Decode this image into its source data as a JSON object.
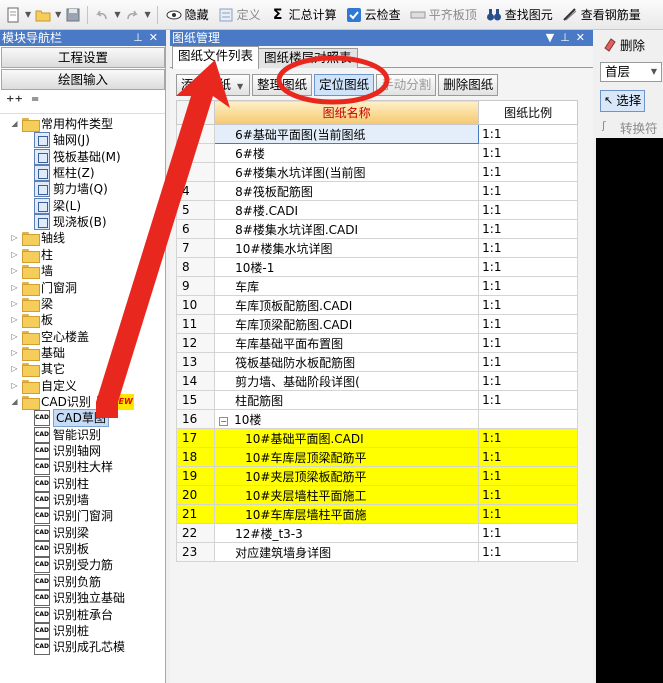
{
  "toolbar": {
    "hide_label": "隐藏",
    "define_label": "定义",
    "summary_label": "汇总计算",
    "cloud_check_label": "云检查",
    "flat_slab_label": "平齐板顶",
    "find_element_label": "查找图元",
    "view_rebar_label": "查看钢筋量"
  },
  "left_panel": {
    "title": "模块导航栏",
    "engineering_settings": "工程设置",
    "drawing_input": "绘图输入",
    "tree": [
      {
        "label": "常用构件类型",
        "kind": "folder",
        "level": 1,
        "expanded": true
      },
      {
        "label": "轴网(J)",
        "kind": "leaf",
        "level": 2
      },
      {
        "label": "筏板基础(M)",
        "kind": "leaf",
        "level": 2
      },
      {
        "label": "框柱(Z)",
        "kind": "leaf",
        "level": 2
      },
      {
        "label": "剪力墙(Q)",
        "kind": "leaf",
        "level": 2
      },
      {
        "label": "梁(L)",
        "kind": "leaf",
        "level": 2
      },
      {
        "label": "现浇板(B)",
        "kind": "leaf",
        "level": 2
      },
      {
        "label": "轴线",
        "kind": "folder",
        "level": 1
      },
      {
        "label": "柱",
        "kind": "folder",
        "level": 1
      },
      {
        "label": "墙",
        "kind": "folder",
        "level": 1
      },
      {
        "label": "门窗洞",
        "kind": "folder",
        "level": 1
      },
      {
        "label": "梁",
        "kind": "folder",
        "level": 1
      },
      {
        "label": "板",
        "kind": "folder",
        "level": 1
      },
      {
        "label": "空心楼盖",
        "kind": "folder",
        "level": 1
      },
      {
        "label": "基础",
        "kind": "folder",
        "level": 1
      },
      {
        "label": "其它",
        "kind": "folder",
        "level": 1
      },
      {
        "label": "自定义",
        "kind": "folder",
        "level": 1
      },
      {
        "label": "CAD识别",
        "kind": "folder",
        "level": 1,
        "expanded": true,
        "badge": "NEW"
      },
      {
        "label": "CAD草图",
        "kind": "cad",
        "level": 2,
        "selected": true
      },
      {
        "label": "智能识别",
        "kind": "cad",
        "level": 2
      },
      {
        "label": "识别轴网",
        "kind": "cad",
        "level": 2
      },
      {
        "label": "识别柱大样",
        "kind": "cad",
        "level": 2
      },
      {
        "label": "识别柱",
        "kind": "cad",
        "level": 2
      },
      {
        "label": "识别墙",
        "kind": "cad",
        "level": 2
      },
      {
        "label": "识别门窗洞",
        "kind": "cad",
        "level": 2
      },
      {
        "label": "识别梁",
        "kind": "cad",
        "level": 2
      },
      {
        "label": "识别板",
        "kind": "cad",
        "level": 2
      },
      {
        "label": "识别受力筋",
        "kind": "cad",
        "level": 2
      },
      {
        "label": "识别负筋",
        "kind": "cad",
        "level": 2
      },
      {
        "label": "识别独立基础",
        "kind": "cad",
        "level": 2
      },
      {
        "label": "识别桩承台",
        "kind": "cad",
        "level": 2
      },
      {
        "label": "识别桩",
        "kind": "cad",
        "level": 2
      },
      {
        "label": "识别成孔芯模",
        "kind": "cad",
        "level": 2
      }
    ]
  },
  "drawing_manager": {
    "title": "图纸管理",
    "tabs": [
      "图纸文件列表",
      "图纸楼层对照表"
    ],
    "buttons": {
      "add": "添加图纸",
      "organize": "整理图纸",
      "locate": "定位图纸",
      "manual_split": "手动分割",
      "delete": "删除图纸"
    },
    "columns": {
      "name": "图纸名称",
      "scale": "图纸比例"
    },
    "rows": [
      {
        "num": "1",
        "name": "6#基础平面图(当前图纸",
        "scale": "1:1",
        "current": true
      },
      {
        "num": "2",
        "name": "6#楼",
        "scale": "1:1"
      },
      {
        "num": "3",
        "name": "6#楼集水坑详图(当前图",
        "scale": "1:1"
      },
      {
        "num": "4",
        "name": "8#筏板配筋图",
        "scale": "1:1"
      },
      {
        "num": "5",
        "name": "8#楼.CADI",
        "scale": "1:1"
      },
      {
        "num": "6",
        "name": "8#楼集水坑详图.CADI",
        "scale": "1:1"
      },
      {
        "num": "7",
        "name": "10#楼集水坑详图",
        "scale": "1:1"
      },
      {
        "num": "8",
        "name": "10楼-1",
        "scale": "1:1"
      },
      {
        "num": "9",
        "name": "车库",
        "scale": "1:1"
      },
      {
        "num": "10",
        "name": "车库顶板配筋图.CADI",
        "scale": "1:1"
      },
      {
        "num": "11",
        "name": "车库顶梁配筋图.CADI",
        "scale": "1:1"
      },
      {
        "num": "12",
        "name": "车库基础平面布置图",
        "scale": "1:1"
      },
      {
        "num": "13",
        "name": "筏板基础防水板配筋图",
        "scale": "1:1"
      },
      {
        "num": "14",
        "name": "剪力墙、基础阶段详图(",
        "scale": "1:1"
      },
      {
        "num": "15",
        "name": "柱配筋图",
        "scale": "1:1"
      },
      {
        "num": "16",
        "name": "10楼",
        "scale": "",
        "group": true
      },
      {
        "num": "17",
        "name": "10#基础平面图.CADI",
        "scale": "1:1",
        "highlight": true
      },
      {
        "num": "18",
        "name": "10#车库层顶梁配筋平",
        "scale": "1:1",
        "highlight": true
      },
      {
        "num": "19",
        "name": "10#夹层顶梁板配筋平",
        "scale": "1:1",
        "highlight": true
      },
      {
        "num": "20",
        "name": "10#夹层墙柱平面施工",
        "scale": "1:1",
        "highlight": true
      },
      {
        "num": "21",
        "name": "10#车库层墙柱平面施",
        "scale": "1:1",
        "highlight": true
      },
      {
        "num": "22",
        "name": "12#楼_t3-3",
        "scale": "1:1"
      },
      {
        "num": "23",
        "name": "对应建筑墙身详图",
        "scale": "1:1"
      }
    ]
  },
  "right_panel": {
    "delete_label": "删除",
    "floor_value": "首层",
    "select_label": "选择",
    "convert_label": "转换符"
  },
  "colors": {
    "title_bar": "#4a7ac6",
    "highlight_rows": "#ffff00",
    "annotation_red": "#e8281e",
    "header_text": "#c00000"
  }
}
